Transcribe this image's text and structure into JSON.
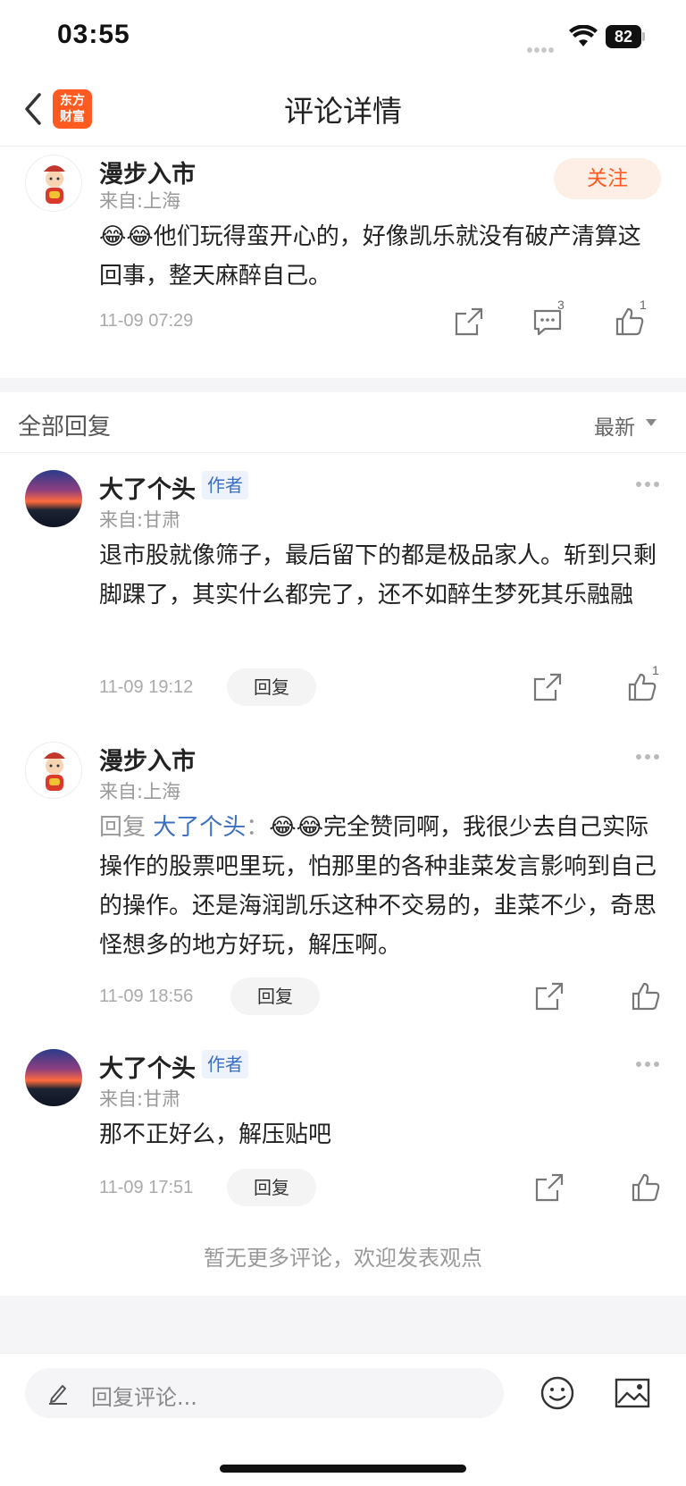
{
  "status_bar": {
    "time": "03:55",
    "battery": "82"
  },
  "nav": {
    "title": "评论详情",
    "logo_line1": "东方",
    "logo_line2": "财富"
  },
  "post": {
    "username": "漫步入市",
    "location": "来自:上海",
    "follow_label": "关注",
    "content": "😂😂他们玩得蛮开心的，好像凯乐就没有破产清算这回事，整天麻醉自己。",
    "time": "11-09 07:29",
    "comment_count": "3",
    "like_count": "1"
  },
  "replies_header": {
    "title": "全部回复",
    "sort": "最新"
  },
  "replies": [
    {
      "username": "大了个头",
      "tag": "作者",
      "location": "来自:甘肃",
      "content": "退市股就像筛子，最后留下的都是极品家人。斩到只剩脚踝了，其实什么都完了，还不如醉生梦死其乐融融",
      "time": "11-09 19:12",
      "reply_label": "回复",
      "like_count": "1"
    },
    {
      "username": "漫步入市",
      "location": "来自:上海",
      "reply_prefix": "回复 ",
      "reply_target": "大了个头",
      "reply_sep": "：",
      "content": "😂😂完全赞同啊，我很少去自己实际操作的股票吧里玩，怕那里的各种韭菜发言影响到自己的操作。还是海润凯乐这种不交易的，韭菜不少，奇思怪想多的地方好玩，解压啊。",
      "time": "11-09 18:56",
      "reply_label": "回复"
    },
    {
      "username": "大了个头",
      "tag": "作者",
      "location": "来自:甘肃",
      "content": "那不正好么，解压贴吧",
      "time": "11-09 17:51",
      "reply_label": "回复"
    }
  ],
  "footer_note": "暂无更多评论，欢迎发表观点",
  "composer": {
    "placeholder": "回复评论..."
  },
  "icons": {
    "back": "chevron-left-icon",
    "share": "share-icon",
    "comment": "comment-icon",
    "like": "thumbs-up-icon",
    "more": "more-dots-icon",
    "pen": "pen-icon",
    "emoji": "smiley-icon",
    "image": "image-icon"
  },
  "colors": {
    "accent": "#ff5a1f",
    "link": "#3b6fc2"
  }
}
